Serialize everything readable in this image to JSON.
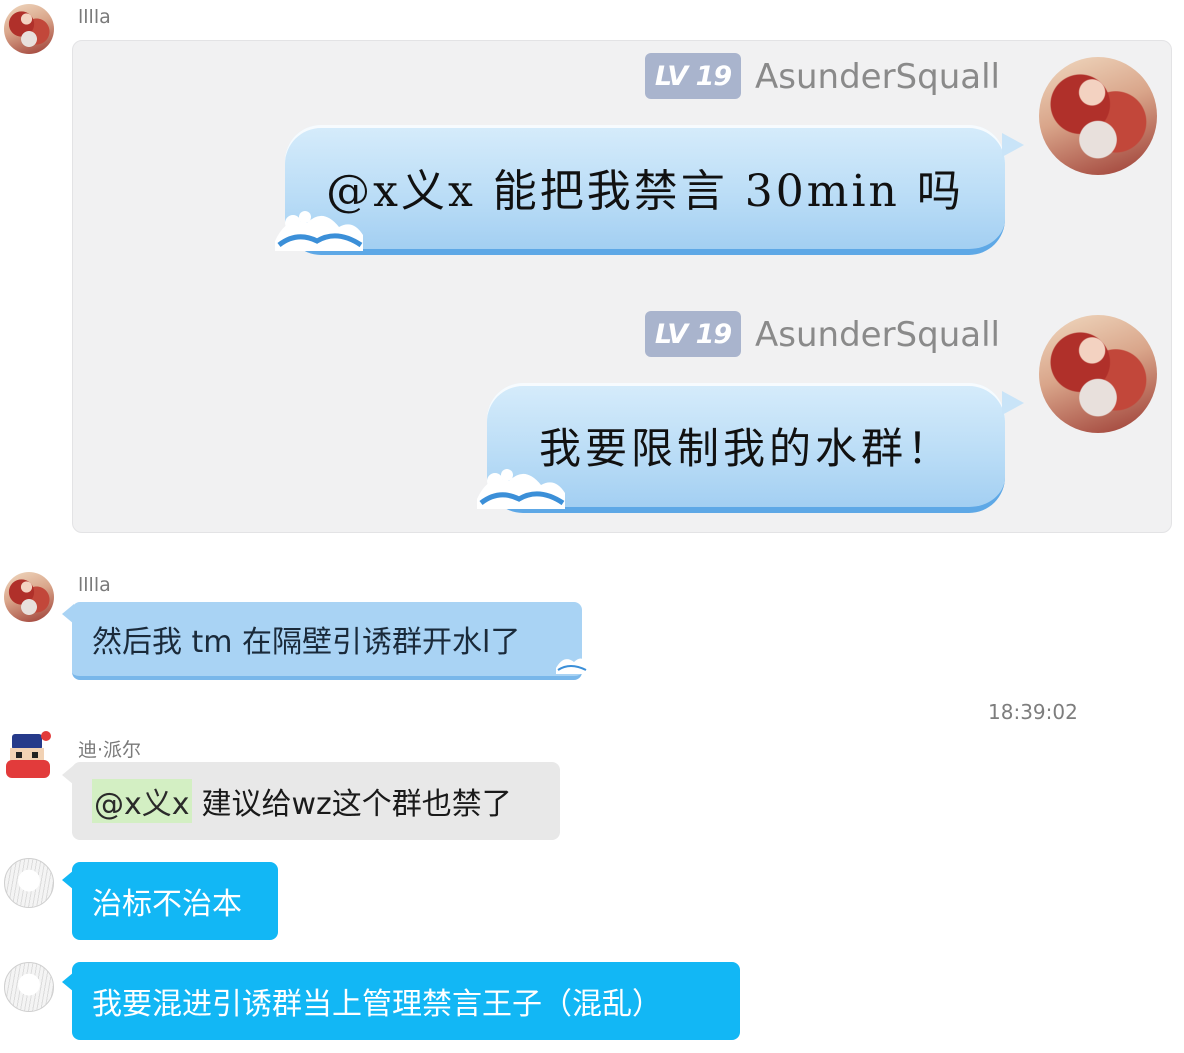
{
  "messages": [
    {
      "sender": "lllla",
      "forwarded": {
        "items": [
          {
            "level": "LV 19",
            "nickname": "AsunderSquall",
            "text": "@x义x 能把我禁言 30min 吗"
          },
          {
            "level": "LV 19",
            "nickname": "AsunderSquall",
            "text": "我要限制我的水群！"
          }
        ]
      }
    },
    {
      "sender": "lllla",
      "text": "然后我 tm 在隔壁引诱群开水l了"
    },
    {
      "timestamp": "18:39:02"
    },
    {
      "sender": "迪·派尔",
      "mention": "@x义x",
      "text": "建议给wz这个群也禁了"
    },
    {
      "text": "治标不治本"
    },
    {
      "text": "我要混进引诱群当上管理禁言王子（混乱）"
    }
  ],
  "colors": {
    "bubble_cyan": "#12b7f5",
    "bubble_light_blue": "#a9d3f4",
    "bubble_gray": "#e8e8e8",
    "level_badge": "#a9b4cd",
    "mention_highlight": "#d3efc3"
  }
}
